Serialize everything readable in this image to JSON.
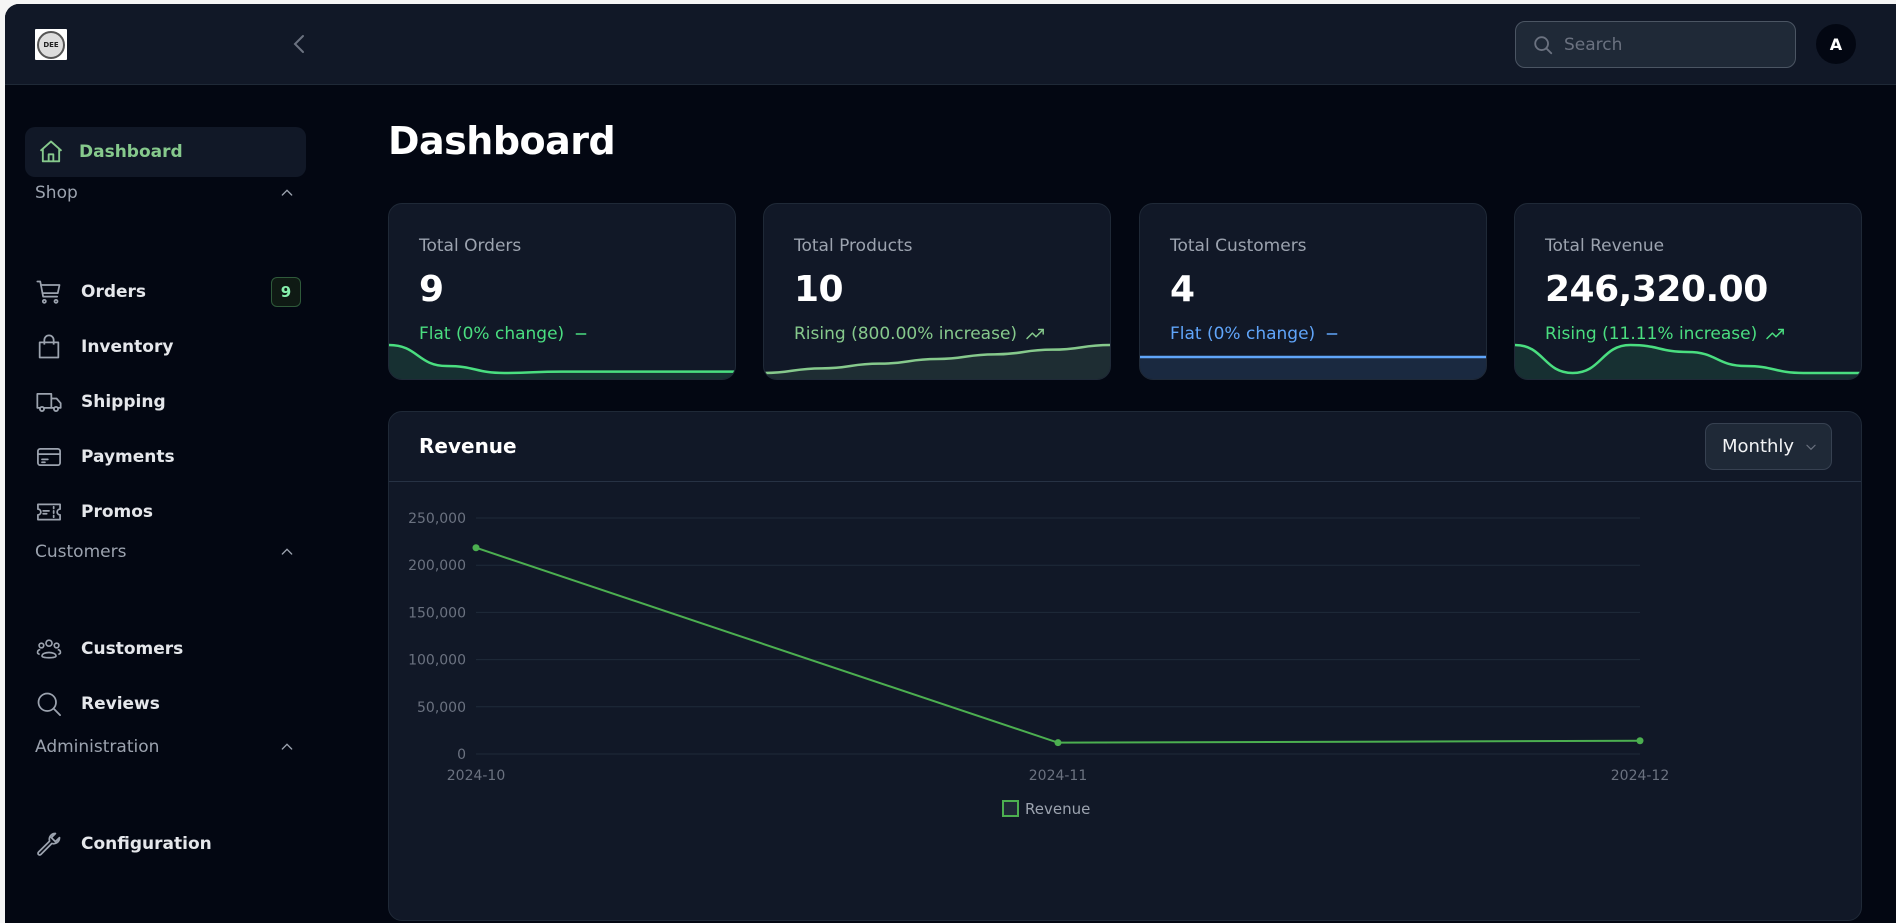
{
  "app": {
    "logo_text": "DEE",
    "search": {
      "placeholder": "Search",
      "value": ""
    },
    "avatar_initial": "A"
  },
  "sidebar": {
    "active": {
      "label": "Dashboard",
      "icon": "home-icon"
    },
    "sections": [
      {
        "label": "Shop",
        "expanded": true,
        "items": [
          {
            "label": "Orders",
            "icon": "cart-icon",
            "badge": "9"
          },
          {
            "label": "Inventory",
            "icon": "shopping-bag-icon"
          },
          {
            "label": "Shipping",
            "icon": "truck-icon"
          },
          {
            "label": "Payments",
            "icon": "credit-card-icon"
          },
          {
            "label": "Promos",
            "icon": "ticket-icon"
          }
        ]
      },
      {
        "label": "Customers",
        "expanded": true,
        "items": [
          {
            "label": "Customers",
            "icon": "users-icon"
          },
          {
            "label": "Reviews",
            "icon": "search-icon"
          }
        ]
      },
      {
        "label": "Administration",
        "expanded": true,
        "items": [
          {
            "label": "Configuration",
            "icon": "wrench-icon"
          }
        ]
      }
    ]
  },
  "main": {
    "title": "Dashboard",
    "stats": [
      {
        "title": "Total Orders",
        "value": "9",
        "trend": "Flat (0% change)",
        "trend_icon": "minus-icon",
        "color": "#4ade80",
        "spark": [
          5,
          2,
          1,
          1.2,
          1.2,
          1.2,
          1.2
        ]
      },
      {
        "title": "Total Products",
        "value": "10",
        "trend": "Rising (800.00% increase)",
        "trend_icon": "trending-up-icon",
        "color": "#86c98c",
        "spark": [
          1,
          2,
          3,
          4,
          5,
          6,
          7
        ]
      },
      {
        "title": "Total Customers",
        "value": "4",
        "trend": "Flat (0% change)",
        "trend_icon": "minus-icon",
        "color": "#60a5fa",
        "spark": [
          4,
          4,
          4,
          4,
          4,
          4,
          4
        ]
      },
      {
        "title": "Total Revenue",
        "value": "246,320.00",
        "trend": "Rising (11.11% increase)",
        "trend_icon": "trending-up-icon",
        "color": "#4ade80",
        "spark": [
          5,
          1,
          5,
          4,
          2,
          1,
          1
        ]
      }
    ],
    "revenue": {
      "title": "Revenue",
      "period": "Monthly"
    }
  },
  "chart_data": {
    "type": "line",
    "title": "Revenue",
    "x": [
      "2024-10",
      "2024-11",
      "2024-12"
    ],
    "series": [
      {
        "name": "Revenue",
        "values": [
          218500,
          12000,
          14000
        ],
        "color": "#4caf50"
      }
    ],
    "ylim": [
      0,
      250000
    ],
    "yticks": [
      0,
      50000,
      100000,
      150000,
      200000,
      250000
    ],
    "ytick_labels": [
      "0",
      "50,000",
      "100,000",
      "150,000",
      "200,000",
      "250,000"
    ],
    "grid": true,
    "legend": "bottom-center",
    "xlabel": "",
    "ylabel": ""
  }
}
